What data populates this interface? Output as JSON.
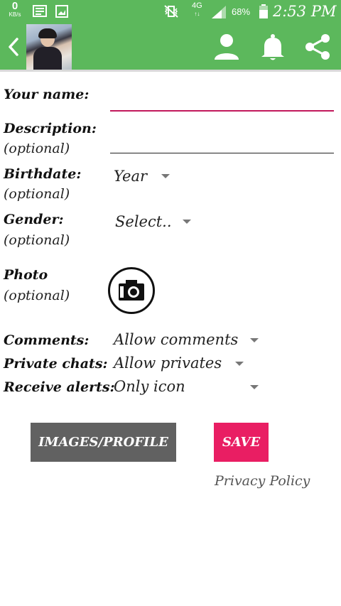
{
  "status_bar": {
    "net_speed_value": "0",
    "net_speed_unit": "KB/s",
    "network_type": "4G",
    "network_sub": "↑↓",
    "battery": "68%",
    "time": "2:53 PM"
  },
  "toolbar": {
    "icons": [
      "back-icon",
      "profile-avatar",
      "person-icon",
      "bell-icon",
      "share-icon"
    ]
  },
  "form": {
    "name_label": "Your name:",
    "name_value": "",
    "description_label": "Description:",
    "description_sub": "(optional)",
    "description_value": "",
    "birthdate_label": "Birthdate:",
    "birthdate_sub": "(optional)",
    "birthdate_value": "Year",
    "gender_label": "Gender:",
    "gender_sub": "(optional)",
    "gender_value": "Select..",
    "photo_label": "Photo",
    "photo_sub": "(optional)",
    "comments_label": "Comments:",
    "comments_value": "Allow comments",
    "chats_label": "Private chats:",
    "chats_value": "Allow privates",
    "alerts_label": "Receive alerts:",
    "alerts_value": "Only icon"
  },
  "actions": {
    "images_profile": "IMAGES/PROFILE",
    "save": "SAVE",
    "privacy_policy": "Privacy Policy"
  },
  "colors": {
    "toolbar": "#5cb85c",
    "save_button": "#e91e63",
    "images_button": "#616161",
    "name_underline": "#c2185b"
  }
}
